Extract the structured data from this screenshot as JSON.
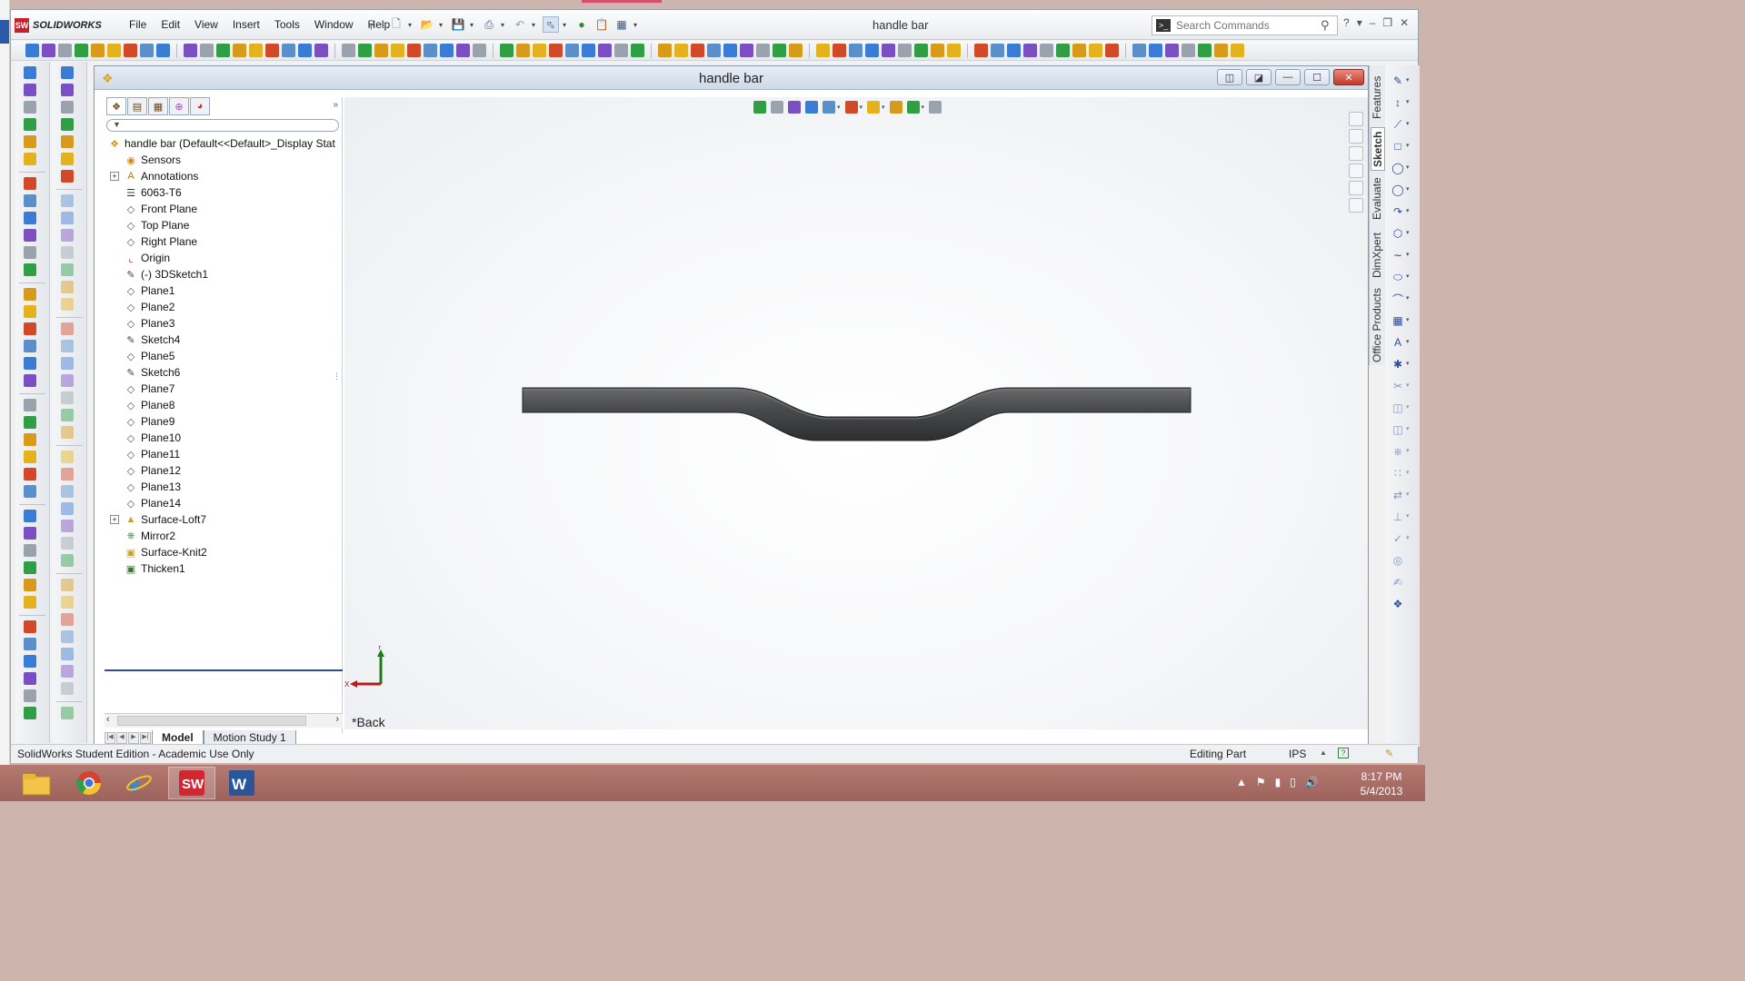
{
  "app": {
    "logo_text": "SOLIDWORKS",
    "window_title": "handle bar",
    "menu": [
      "File",
      "Edit",
      "View",
      "Insert",
      "Tools",
      "Window",
      "Help"
    ],
    "search_placeholder": "Search Commands",
    "help_icon": "?"
  },
  "document": {
    "title": "handle bar",
    "view_label": "*Back",
    "bottom_tabs": [
      "Model",
      "Motion Study 1"
    ],
    "triad": {
      "x": "X",
      "y": "Y"
    }
  },
  "feature_tree": {
    "items": [
      {
        "label": "handle bar  (Default<<Default>_Display Stat",
        "icon": "part-icon",
        "expandable": false,
        "root": true
      },
      {
        "label": "Sensors",
        "icon": "sensors-icon",
        "expandable": false
      },
      {
        "label": "Annotations",
        "icon": "annotations-icon",
        "expandable": true
      },
      {
        "label": "6063-T6",
        "icon": "material-icon",
        "expandable": false
      },
      {
        "label": "Front Plane",
        "icon": "plane-icon",
        "expandable": false
      },
      {
        "label": "Top Plane",
        "icon": "plane-icon",
        "expandable": false
      },
      {
        "label": "Right Plane",
        "icon": "plane-icon",
        "expandable": false
      },
      {
        "label": "Origin",
        "icon": "origin-icon",
        "expandable": false
      },
      {
        "label": "(-) 3DSketch1",
        "icon": "3dsketch-icon",
        "expandable": false
      },
      {
        "label": "Plane1",
        "icon": "plane-icon",
        "expandable": false
      },
      {
        "label": "Plane2",
        "icon": "plane-icon",
        "expandable": false
      },
      {
        "label": "Plane3",
        "icon": "plane-icon",
        "expandable": false
      },
      {
        "label": "Sketch4",
        "icon": "sketch-icon",
        "expandable": false
      },
      {
        "label": "Plane5",
        "icon": "plane-icon",
        "expandable": false
      },
      {
        "label": "Sketch6",
        "icon": "sketch-icon",
        "expandable": false
      },
      {
        "label": "Plane7",
        "icon": "plane-icon",
        "expandable": false
      },
      {
        "label": "Plane8",
        "icon": "plane-icon",
        "expandable": false
      },
      {
        "label": "Plane9",
        "icon": "plane-icon",
        "expandable": false
      },
      {
        "label": "Plane10",
        "icon": "plane-icon",
        "expandable": false
      },
      {
        "label": "Plane11",
        "icon": "plane-icon",
        "expandable": false
      },
      {
        "label": "Plane12",
        "icon": "plane-icon",
        "expandable": false
      },
      {
        "label": "Plane13",
        "icon": "plane-icon",
        "expandable": false
      },
      {
        "label": "Plane14",
        "icon": "plane-icon",
        "expandable": false
      },
      {
        "label": "Surface-Loft7",
        "icon": "surface-loft-icon",
        "expandable": true
      },
      {
        "label": "Mirror2",
        "icon": "mirror-icon",
        "expandable": false
      },
      {
        "label": "Surface-Knit2",
        "icon": "surface-knit-icon",
        "expandable": false
      },
      {
        "label": "Thicken1",
        "icon": "thicken-icon",
        "expandable": false
      }
    ]
  },
  "command_manager_tabs": [
    "Features",
    "Sketch",
    "Evaluate",
    "DimXpert",
    "Office Products"
  ],
  "active_cm_tab": "Sketch",
  "status_bar": {
    "left": "SolidWorks Student Edition - Academic Use Only",
    "mode": "Editing Part",
    "units": "IPS"
  },
  "taskbar": {
    "apps": [
      "file-explorer-icon",
      "chrome-icon",
      "internet-explorer-icon",
      "solidworks-icon",
      "word-icon"
    ],
    "time": "8:17 PM",
    "date": "5/4/2013"
  },
  "colors": {
    "accent": "#2a4d9c",
    "sw_red": "#c8202b",
    "taskbar": "#a96c64",
    "model_gray": "#4a4b4d"
  }
}
